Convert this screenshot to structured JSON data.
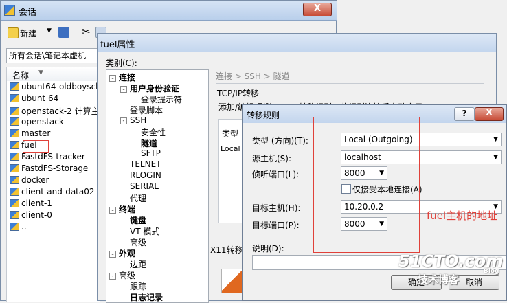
{
  "session_window": {
    "title": "会话",
    "close_glyph": "X",
    "toolbar": {
      "new_label": "新建",
      "props_label": "属性"
    },
    "path": "所有会话\\笔记本虚机",
    "column_name": "名称",
    "sessions": [
      "ubunt64-oldboyschool",
      "ubunt 64",
      "openstack-2 计算主机",
      "openstack",
      "master",
      "fuel",
      "FastdFS-tracker",
      "FastdFS-Storage",
      "docker",
      "client-and-data02",
      "client-1",
      "client-0",
      ".."
    ]
  },
  "props_window": {
    "title": "fuel属性",
    "category_label": "类别(C):",
    "breadcrumb": "连接 > SSH > 隧道",
    "section_title": "TCP/IP转移",
    "section_desc": "添加/编辑/删除TCP/IP转移规则，此规则连接后自动应用：",
    "group_label": "类型",
    "group_item": "Local",
    "x11_label": "X11转移",
    "tree": [
      {
        "label": "连接",
        "level": 0,
        "bold": true,
        "box": "-"
      },
      {
        "label": "用户身份验证",
        "level": 1,
        "bold": true,
        "box": "-"
      },
      {
        "label": "登录提示符",
        "level": 2,
        "bold": false
      },
      {
        "label": "登录脚本",
        "level": 1,
        "bold": false
      },
      {
        "label": "SSH",
        "level": 1,
        "bold": false,
        "box": "-"
      },
      {
        "label": "安全性",
        "level": 2,
        "bold": false
      },
      {
        "label": "隧道",
        "level": 2,
        "bold": true
      },
      {
        "label": "SFTP",
        "level": 2,
        "bold": false
      },
      {
        "label": "TELNET",
        "level": 1,
        "bold": false
      },
      {
        "label": "RLOGIN",
        "level": 1,
        "bold": false
      },
      {
        "label": "SERIAL",
        "level": 1,
        "bold": false
      },
      {
        "label": "代理",
        "level": 1,
        "bold": false
      },
      {
        "label": "终端",
        "level": 0,
        "bold": true,
        "box": "-"
      },
      {
        "label": "键盘",
        "level": 1,
        "bold": true
      },
      {
        "label": "VT 模式",
        "level": 1,
        "bold": false
      },
      {
        "label": "高级",
        "level": 1,
        "bold": false
      },
      {
        "label": "外观",
        "level": 0,
        "bold": true,
        "box": "-"
      },
      {
        "label": "边距",
        "level": 1,
        "bold": false
      },
      {
        "label": "高级",
        "level": 0,
        "bold": false,
        "box": "-"
      },
      {
        "label": "跟踪",
        "level": 1,
        "bold": false
      },
      {
        "label": "日志记录",
        "level": 1,
        "bold": true
      }
    ]
  },
  "rule_dialog": {
    "title": "转移规则",
    "help_glyph": "?",
    "close_glyph": "X",
    "type_label": "类型 (方向)(T):",
    "type_value": "Local (Outgoing)",
    "source_host_label": "源主机(S):",
    "source_host_value": "localhost",
    "listen_port_label": "侦听端口(L):",
    "listen_port_value": "8000",
    "local_only_label": "仅接受本地连接(A)",
    "target_host_label": "目标主机(H):",
    "target_host_value": "10.20.0.2",
    "target_port_label": "目标端口(P):",
    "target_port_value": "8000",
    "desc_label": "说明(D):",
    "ok_label": "确定",
    "cancel_label": "取消",
    "annotation": "fuel主机的地址"
  },
  "watermark": {
    "line1": "51CTO.com",
    "line2": "技术博客",
    "line3": "Blog"
  },
  "colors": {
    "annotation": "#e0413a",
    "title_bar": "#c4d6ee",
    "close_button": "#c74b36"
  }
}
